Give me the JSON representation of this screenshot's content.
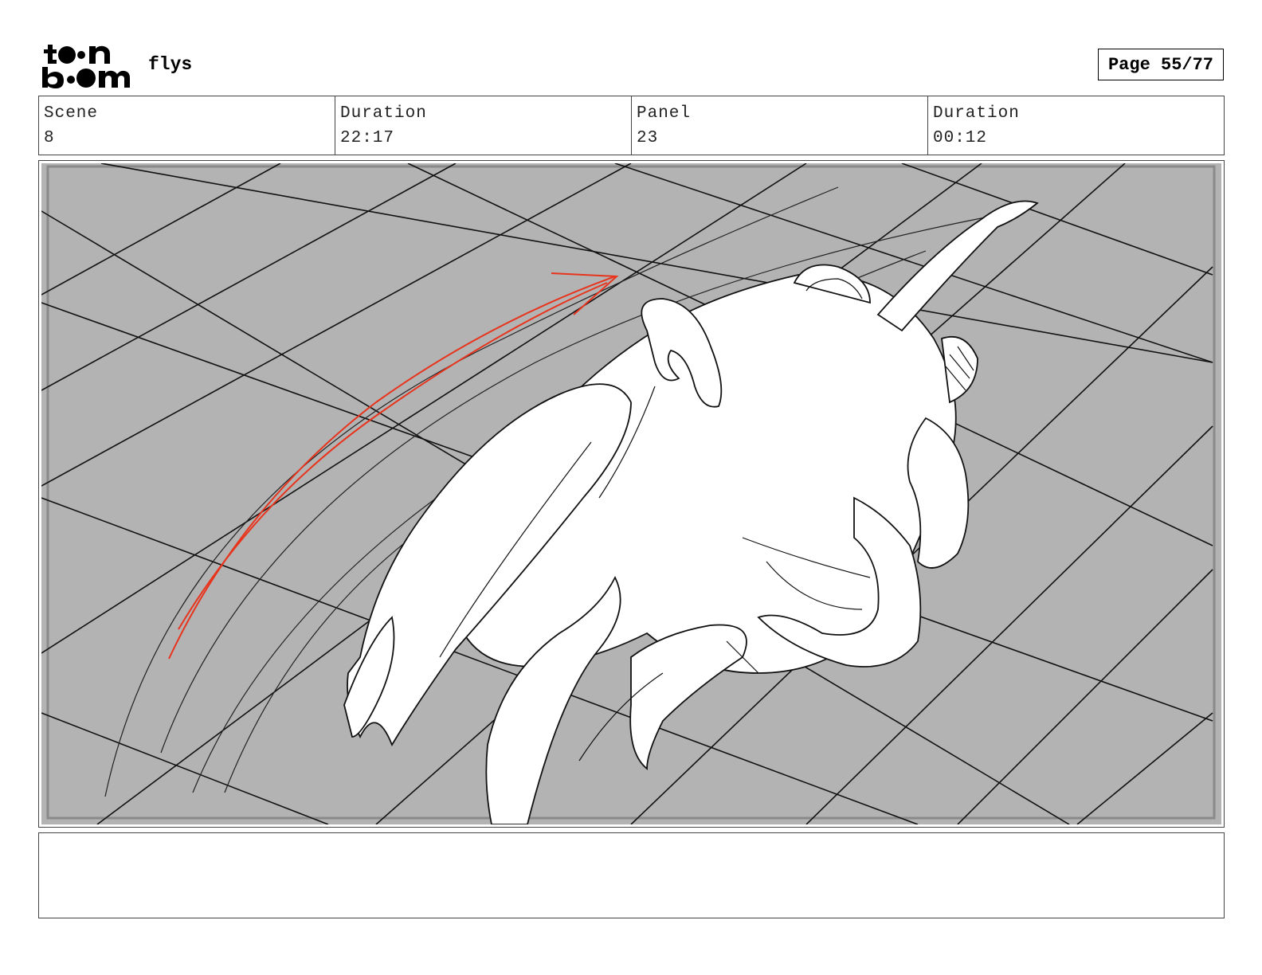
{
  "header": {
    "logo_icon": "toonboom-logo",
    "project_title": "flys",
    "page_label": "Page 55/77"
  },
  "info": [
    {
      "label": "Scene",
      "value": "8"
    },
    {
      "label": "Duration",
      "value": "22:17"
    },
    {
      "label": "Panel",
      "value": "23"
    },
    {
      "label": "Duration",
      "value": "00:12"
    }
  ],
  "panel": {
    "image_icon": "storyboard-sketch-flying-creature",
    "background_color": "#b3b3b3",
    "accent_color": "#e8341c"
  },
  "notes": {
    "text": ""
  }
}
